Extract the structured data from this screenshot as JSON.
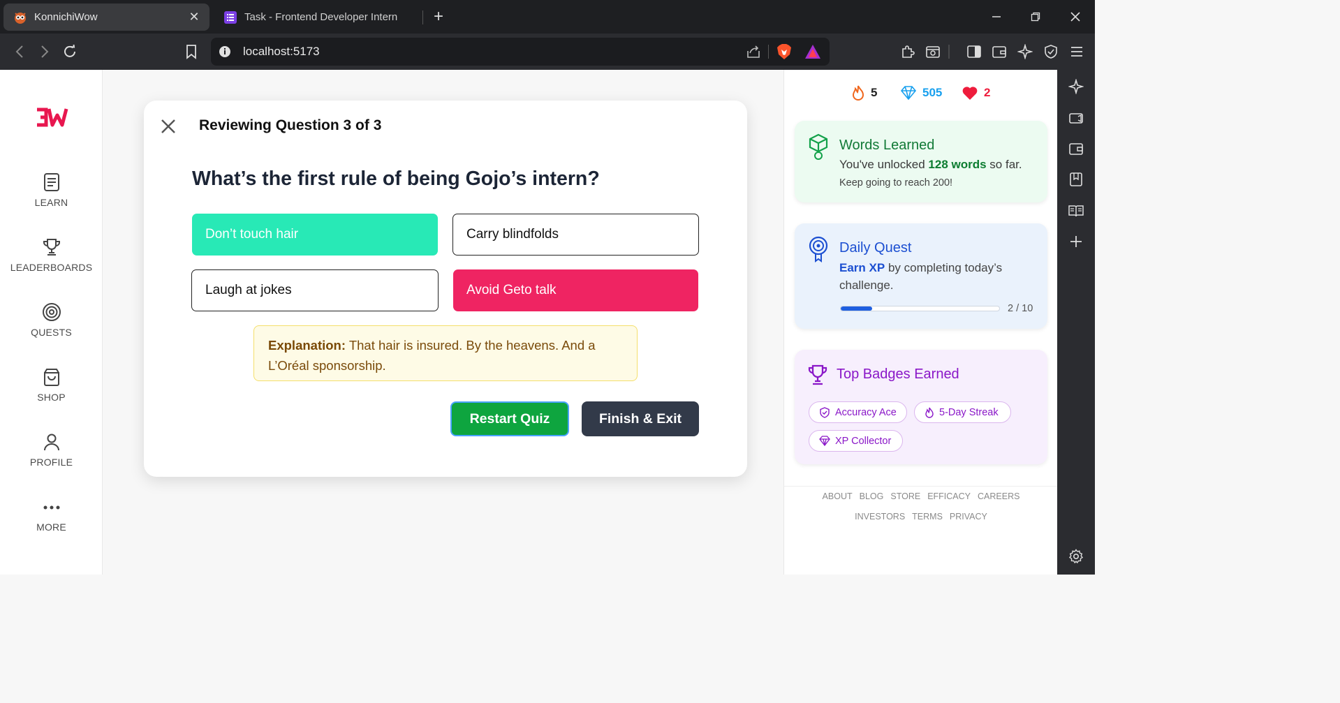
{
  "browser": {
    "tabs": [
      {
        "title": "KonnichiWow",
        "active": true
      },
      {
        "title": "Task - Frontend Developer Intern",
        "active": false
      }
    ],
    "url": "localhost:5173"
  },
  "nav": {
    "items": [
      {
        "label": "LEARN",
        "icon": "book-icon"
      },
      {
        "label": "LEADERBOARDS",
        "icon": "trophy-icon"
      },
      {
        "label": "QUESTS",
        "icon": "target-icon"
      },
      {
        "label": "SHOP",
        "icon": "shopping-bag-icon"
      },
      {
        "label": "PROFILE",
        "icon": "user-icon"
      },
      {
        "label": "MORE",
        "icon": "more-dots-icon"
      }
    ]
  },
  "quiz": {
    "review_title": "Reviewing Question 3 of 3",
    "question": "What’s the first rule of being Gojo’s intern?",
    "options": [
      {
        "text": "Don’t touch hair",
        "state": "correct"
      },
      {
        "text": "Carry blindfolds",
        "state": "neutral"
      },
      {
        "text": "Laugh at jokes",
        "state": "neutral"
      },
      {
        "text": "Avoid Geto talk",
        "state": "wrong"
      }
    ],
    "explanation_label": "Explanation:",
    "explanation_text": "That hair is insured. By the heavens. And a L’Oréal sponsorship.",
    "restart_label": "Restart Quiz",
    "finish_label": "Finish & Exit"
  },
  "stats": {
    "streak": "5",
    "gems": "505",
    "hearts": "2"
  },
  "words_card": {
    "title": "Words Learned",
    "line_prefix": "You've unlocked",
    "count_text": "128 words",
    "line_suffix": "so far.",
    "subtext": "Keep going to reach 200!"
  },
  "quest_card": {
    "title": "Daily Quest",
    "earn_label": "Earn XP",
    "body_suffix": "by completing today’s challenge.",
    "progress_text": "2 / 10",
    "progress_fraction": 0.2
  },
  "badges_card": {
    "title": "Top Badges Earned",
    "badges": [
      "Accuracy Ace",
      "5-Day Streak",
      "XP Collector"
    ]
  },
  "footer": {
    "row1": [
      "ABOUT",
      "BLOG",
      "STORE",
      "EFFICACY",
      "CAREERS"
    ],
    "row2": [
      "INVESTORS",
      "TERMS",
      "PRIVACY"
    ]
  },
  "colors": {
    "correct": "#28e9b6",
    "wrong": "#ef2462",
    "restart": "#0ea53f",
    "finish": "#323a49",
    "brand_red": "#e8174f"
  }
}
